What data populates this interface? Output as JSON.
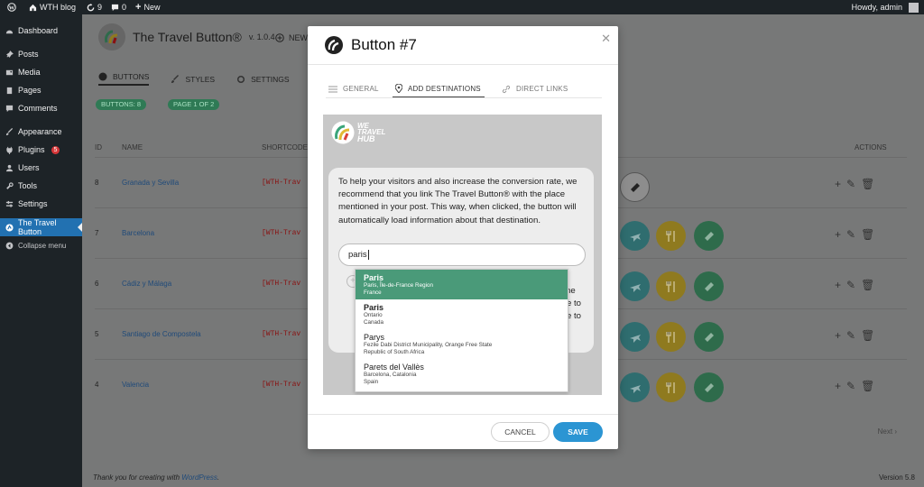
{
  "adminbar": {
    "site": "WTH blog",
    "updates": "9",
    "comments": "0",
    "new": "New",
    "howdy": "Howdy, admin"
  },
  "sidebar": {
    "items": [
      {
        "label": "Dashboard",
        "icon": "dashboard-icon"
      },
      {
        "label": "Posts",
        "icon": "pin-icon"
      },
      {
        "label": "Media",
        "icon": "media-icon"
      },
      {
        "label": "Pages",
        "icon": "page-icon"
      },
      {
        "label": "Comments",
        "icon": "comment-icon"
      },
      {
        "label": "Appearance",
        "icon": "brush-icon"
      },
      {
        "label": "Plugins",
        "icon": "plugin-icon",
        "badge": "5"
      },
      {
        "label": "Users",
        "icon": "users-icon"
      },
      {
        "label": "Tools",
        "icon": "wrench-icon"
      },
      {
        "label": "Settings",
        "icon": "settings-icon"
      },
      {
        "label": "The Travel Button",
        "icon": "travel-button-icon",
        "active": true
      },
      {
        "label": "Collapse menu",
        "icon": "collapse-icon"
      }
    ]
  },
  "plugin": {
    "title": "The Travel Button®",
    "version": "v. 1.0.4",
    "new_button": "NEW",
    "tabs": [
      "BUTTONS",
      "STYLES",
      "SETTINGS"
    ],
    "buttons_count": "BUTTONS: 8",
    "page": "PAGE 1 OF 2",
    "columns": {
      "id": "ID",
      "name": "NAME",
      "shortcode": "SHORTCODE",
      "actions": "ACTIONS"
    },
    "rows": [
      {
        "id": "8",
        "name": "Granada y Sevilla",
        "shortcode": "[WTH-Trav"
      },
      {
        "id": "7",
        "name": "Barcelona",
        "shortcode": "[WTH-Trav"
      },
      {
        "id": "6",
        "name": "Cádiz y Málaga",
        "shortcode": "[WTH-Trav"
      },
      {
        "id": "5",
        "name": "Santiago de Compostela",
        "shortcode": "[WTH-Trav"
      },
      {
        "id": "4",
        "name": "Valencia",
        "shortcode": "[WTH-Trav"
      }
    ],
    "next": "Next",
    "footer_text": "Thank you for creating with ",
    "footer_link": "WordPress",
    "footer_period": ".",
    "wp_version": "Version 5.8"
  },
  "modal": {
    "title": "Button #7",
    "tabs": [
      {
        "label": "GENERAL",
        "icon": "list-icon"
      },
      {
        "label": "ADD DESTINATIONS",
        "icon": "location-pin-icon",
        "active": true
      },
      {
        "label": "DIRECT LINKS",
        "icon": "link-icon"
      }
    ],
    "logo_lines": [
      "WE",
      "TRAVEL",
      "HUB"
    ],
    "info_text": "To help your visitors and also increase the conversion rate, we recommend that you link The Travel Button® with the place mentioned in your post. This way, when clicked, the button will automatically load information about that destination.",
    "search_value": "paris",
    "hidden_fragments": [
      "he",
      "e to",
      "e to"
    ],
    "suggestions": [
      {
        "name": "Paris",
        "region": "Paris, Île-de-France Region",
        "country": "France"
      },
      {
        "name": "Paris",
        "region": "Ontario",
        "country": "Canada"
      },
      {
        "name": "Parys",
        "region": "Fezile Dabi District Municipality, Orange Free State",
        "country": "Republic of South Africa"
      },
      {
        "name": "Parets del Vallès",
        "region": "Barcelona, Catalonia",
        "country": "Spain"
      }
    ],
    "cancel": "CANCEL",
    "save": "SAVE"
  },
  "colors": {
    "accent": "#2b95d3",
    "highlight": "#4a9a79",
    "admin_bg": "#1d2327",
    "active_menu": "#2271b1"
  }
}
